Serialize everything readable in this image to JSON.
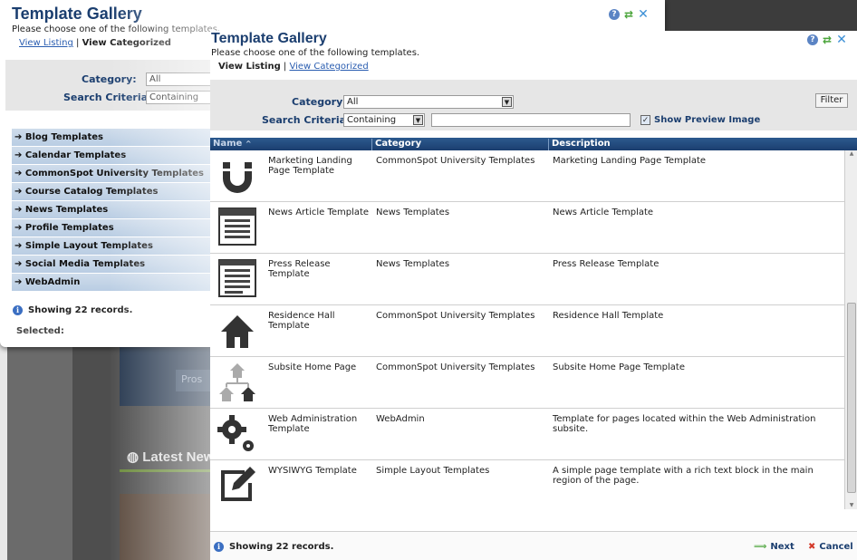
{
  "background": {
    "news_heading": "Latest New",
    "banner_button": "Pros"
  },
  "back_dialog": {
    "title": "Template Gallery",
    "subtitle": "Please choose one of the following templates.",
    "view_listing": "View Listing",
    "separator": "|",
    "view_categorized": "View Categorized",
    "category_label": "Category:",
    "category_value": "All",
    "search_label": "Search Criteria:",
    "search_value": "Containing",
    "categories": [
      "Blog Templates",
      "Calendar Templates",
      "CommonSpot University Templates",
      "Course Catalog Templates",
      "News Templates",
      "Profile Templates",
      "Simple Layout Templates",
      "Social Media Templates",
      "WebAdmin"
    ],
    "showing": "Showing 22 records.",
    "selected": "Selected:"
  },
  "front_dialog": {
    "title": "Template Gallery",
    "subtitle": "Please choose one of the following templates.",
    "view_listing": "View Listing",
    "separator": "|",
    "view_categorized": "View Categorized",
    "category_label": "Category:",
    "category_value": "All",
    "search_label": "Search Criteria:",
    "search_value": "Containing",
    "search_text": "",
    "show_preview_label": "Show Preview Image",
    "show_preview_checked": true,
    "filter_button": "Filter",
    "columns": {
      "name": "Name",
      "category": "Category",
      "description": "Description"
    },
    "sort_indicator": "^",
    "rows": [
      {
        "icon": "magnet-icon",
        "name": "Marketing Landing Page Template",
        "category": "CommonSpot University Templates",
        "description": "Marketing Landing Page Template"
      },
      {
        "icon": "news-article-icon",
        "name": "News Article Template",
        "category": "News Templates",
        "description": "News Article Template"
      },
      {
        "icon": "press-release-icon",
        "name": "Press Release Template",
        "category": "News Templates",
        "description": "Press Release Template"
      },
      {
        "icon": "house-icon",
        "name": "Residence Hall Template",
        "category": "CommonSpot University Templates",
        "description": "Residence Hall Template"
      },
      {
        "icon": "subsite-tree-icon",
        "name": "Subsite Home Page",
        "category": "CommonSpot University Templates",
        "description": "Subsite Home Page Template"
      },
      {
        "icon": "gears-icon",
        "name": "Web Administration Template",
        "category": "WebAdmin",
        "description": "Template for pages located within the Web Administration subsite."
      },
      {
        "icon": "edit-pencil-icon",
        "name": "WYSIWYG Template",
        "category": "Simple Layout Templates",
        "description": "A simple page template with a rich text block in the main region of the page."
      }
    ],
    "showing": "Showing 22 records.",
    "next": "Next",
    "cancel": "Cancel"
  },
  "colors": {
    "title_blue": "#1b3e6f",
    "header_blue": "#1b3e6f",
    "category_bar": "#c4d5e8",
    "next_arrow": "#4aa43a",
    "cancel_x": "#d43a2a"
  }
}
